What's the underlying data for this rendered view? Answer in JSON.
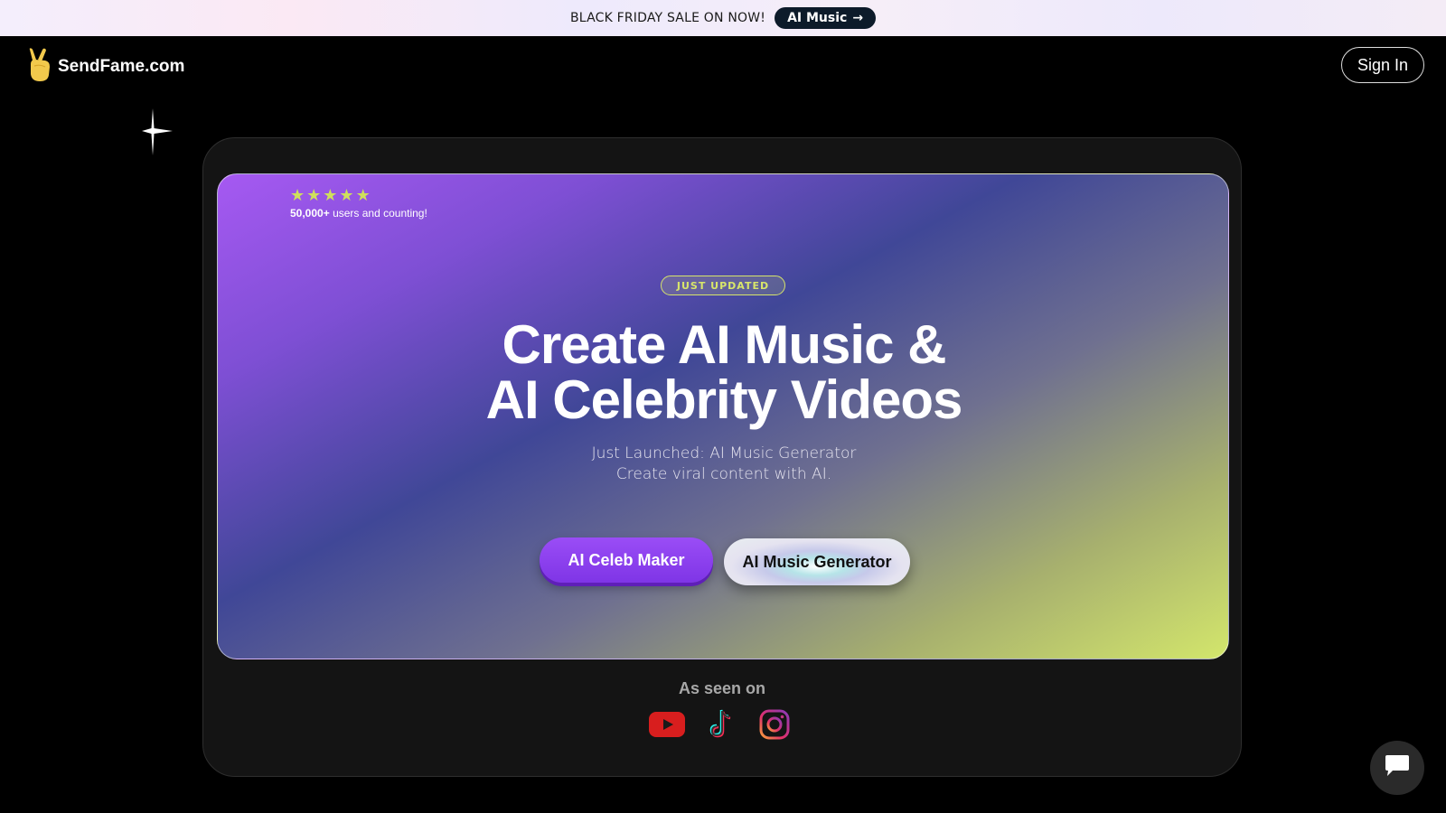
{
  "promo": {
    "text": "BLACK FRIDAY SALE ON NOW!",
    "link_label": "AI Music",
    "link_arrow": "→"
  },
  "header": {
    "logo_icon": "victory-hand-icon",
    "logo_text": "SendFame.com",
    "signin_label": "Sign In"
  },
  "hero": {
    "rating": {
      "stars": 5,
      "count": "50,000+",
      "suffix": "users and counting!"
    },
    "badge": "JUST UPDATED",
    "headline_line1": "Create AI Music &",
    "headline_line2": "AI Celebrity Videos",
    "sub_line1": "Just Launched: AI Music Generator",
    "sub_line2": "Create viral content with AI.",
    "primary_button": "AI Celeb Maker",
    "secondary_button": "AI Music Generator"
  },
  "seen_on": {
    "title": "As seen on",
    "platforms": [
      "youtube-icon",
      "tiktok-icon",
      "instagram-icon"
    ]
  },
  "chat": {
    "icon": "chat-bubble-icon"
  },
  "colors": {
    "accent_purple": "#8b3ff0",
    "accent_lime": "#d3e66c",
    "background": "#000000",
    "card": "#141414"
  }
}
